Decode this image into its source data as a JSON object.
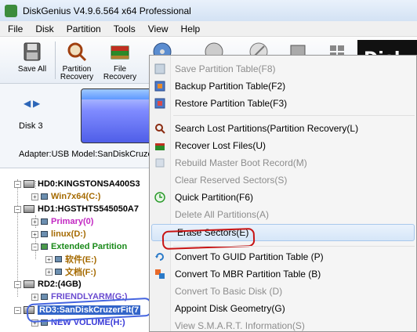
{
  "window": {
    "title": "DiskGenius V4.9.6.564 x64 Professional"
  },
  "menubar": [
    "File",
    "Disk",
    "Partition",
    "Tools",
    "View",
    "Help"
  ],
  "toolbar": {
    "save_all": "Save All",
    "partition_recovery": "Partition\nRecovery",
    "file_recovery": "File\nRecovery",
    "logo_text": "Disk"
  },
  "disk_panel": {
    "disk_label": "Disk  3",
    "adapter": "Adapter:USB  Model:SanDiskCruze"
  },
  "tree": [
    {
      "label": "HD0:KINGSTONSA400S3",
      "kind": "disk",
      "expander": "-"
    },
    {
      "label": "Win7x64(C:)",
      "kind": "partition",
      "expander": "+"
    },
    {
      "label": "HD1:HGSTHTS545050A7",
      "kind": "disk",
      "expander": "-"
    },
    {
      "label": "Primary(0)",
      "kind": "partition",
      "expander": "+"
    },
    {
      "label": "linux(D:)",
      "kind": "partition",
      "expander": "+"
    },
    {
      "label": "Extended Partition",
      "kind": "extended",
      "expander": "-"
    },
    {
      "label": "软件(E:)",
      "kind": "partition",
      "expander": "+"
    },
    {
      "label": "文档(F:)",
      "kind": "partition",
      "expander": "+"
    },
    {
      "label": "RD2:(4GB)",
      "kind": "disk",
      "expander": "-"
    },
    {
      "label": "FRIENDLYARM(G:)",
      "kind": "partition",
      "expander": "+"
    },
    {
      "label": "RD3:SanDiskCruzerFit(7",
      "kind": "disk",
      "expander": "-"
    },
    {
      "label": "NEW VOLUME(H:)",
      "kind": "partition",
      "expander": "+"
    }
  ],
  "context_menu": {
    "items": [
      {
        "label": "Save Partition Table(F8)",
        "enabled": false,
        "icon": "save-icon"
      },
      {
        "label": "Backup Partition Table(F2)",
        "enabled": true,
        "icon": "backup-table-icon"
      },
      {
        "label": "Restore Partition Table(F3)",
        "enabled": true,
        "icon": "restore-table-icon"
      },
      {
        "label": "Search Lost Partitions(Partition Recovery(L)",
        "enabled": true,
        "icon": "search-partition-icon"
      },
      {
        "label": "Recover Lost Files(U)",
        "enabled": true,
        "icon": "recover-files-icon"
      },
      {
        "label": "Rebuild Master Boot Record(M)",
        "enabled": false,
        "icon": "mbr-icon"
      },
      {
        "label": "Clear Reserved Sectors(S)",
        "enabled": false,
        "icon": "none"
      },
      {
        "label": "Quick Partition(F6)",
        "enabled": true,
        "icon": "quick-partition-icon"
      },
      {
        "label": "Delete All Partitions(A)",
        "enabled": false,
        "icon": "none"
      },
      {
        "label": "Erase Sectors(E)",
        "enabled": true,
        "icon": "none"
      },
      {
        "label": "Convert To GUID Partition Table (P)",
        "enabled": true,
        "icon": "convert-gpt-icon"
      },
      {
        "label": "Convert To MBR Partition Table (B)",
        "enabled": true,
        "icon": "convert-mbr-icon"
      },
      {
        "label": "Convert To Basic Disk (D)",
        "enabled": false,
        "icon": "none"
      },
      {
        "label": "Appoint Disk Geometry(G)",
        "enabled": true,
        "icon": "none"
      },
      {
        "label": "View S.M.A.R.T. Information(S)",
        "enabled": false,
        "icon": "none"
      }
    ]
  },
  "colors": {
    "highlight_border": "#a8c8ec",
    "annotation_red": "#c81414",
    "annotation_blue": "#4464e0"
  }
}
